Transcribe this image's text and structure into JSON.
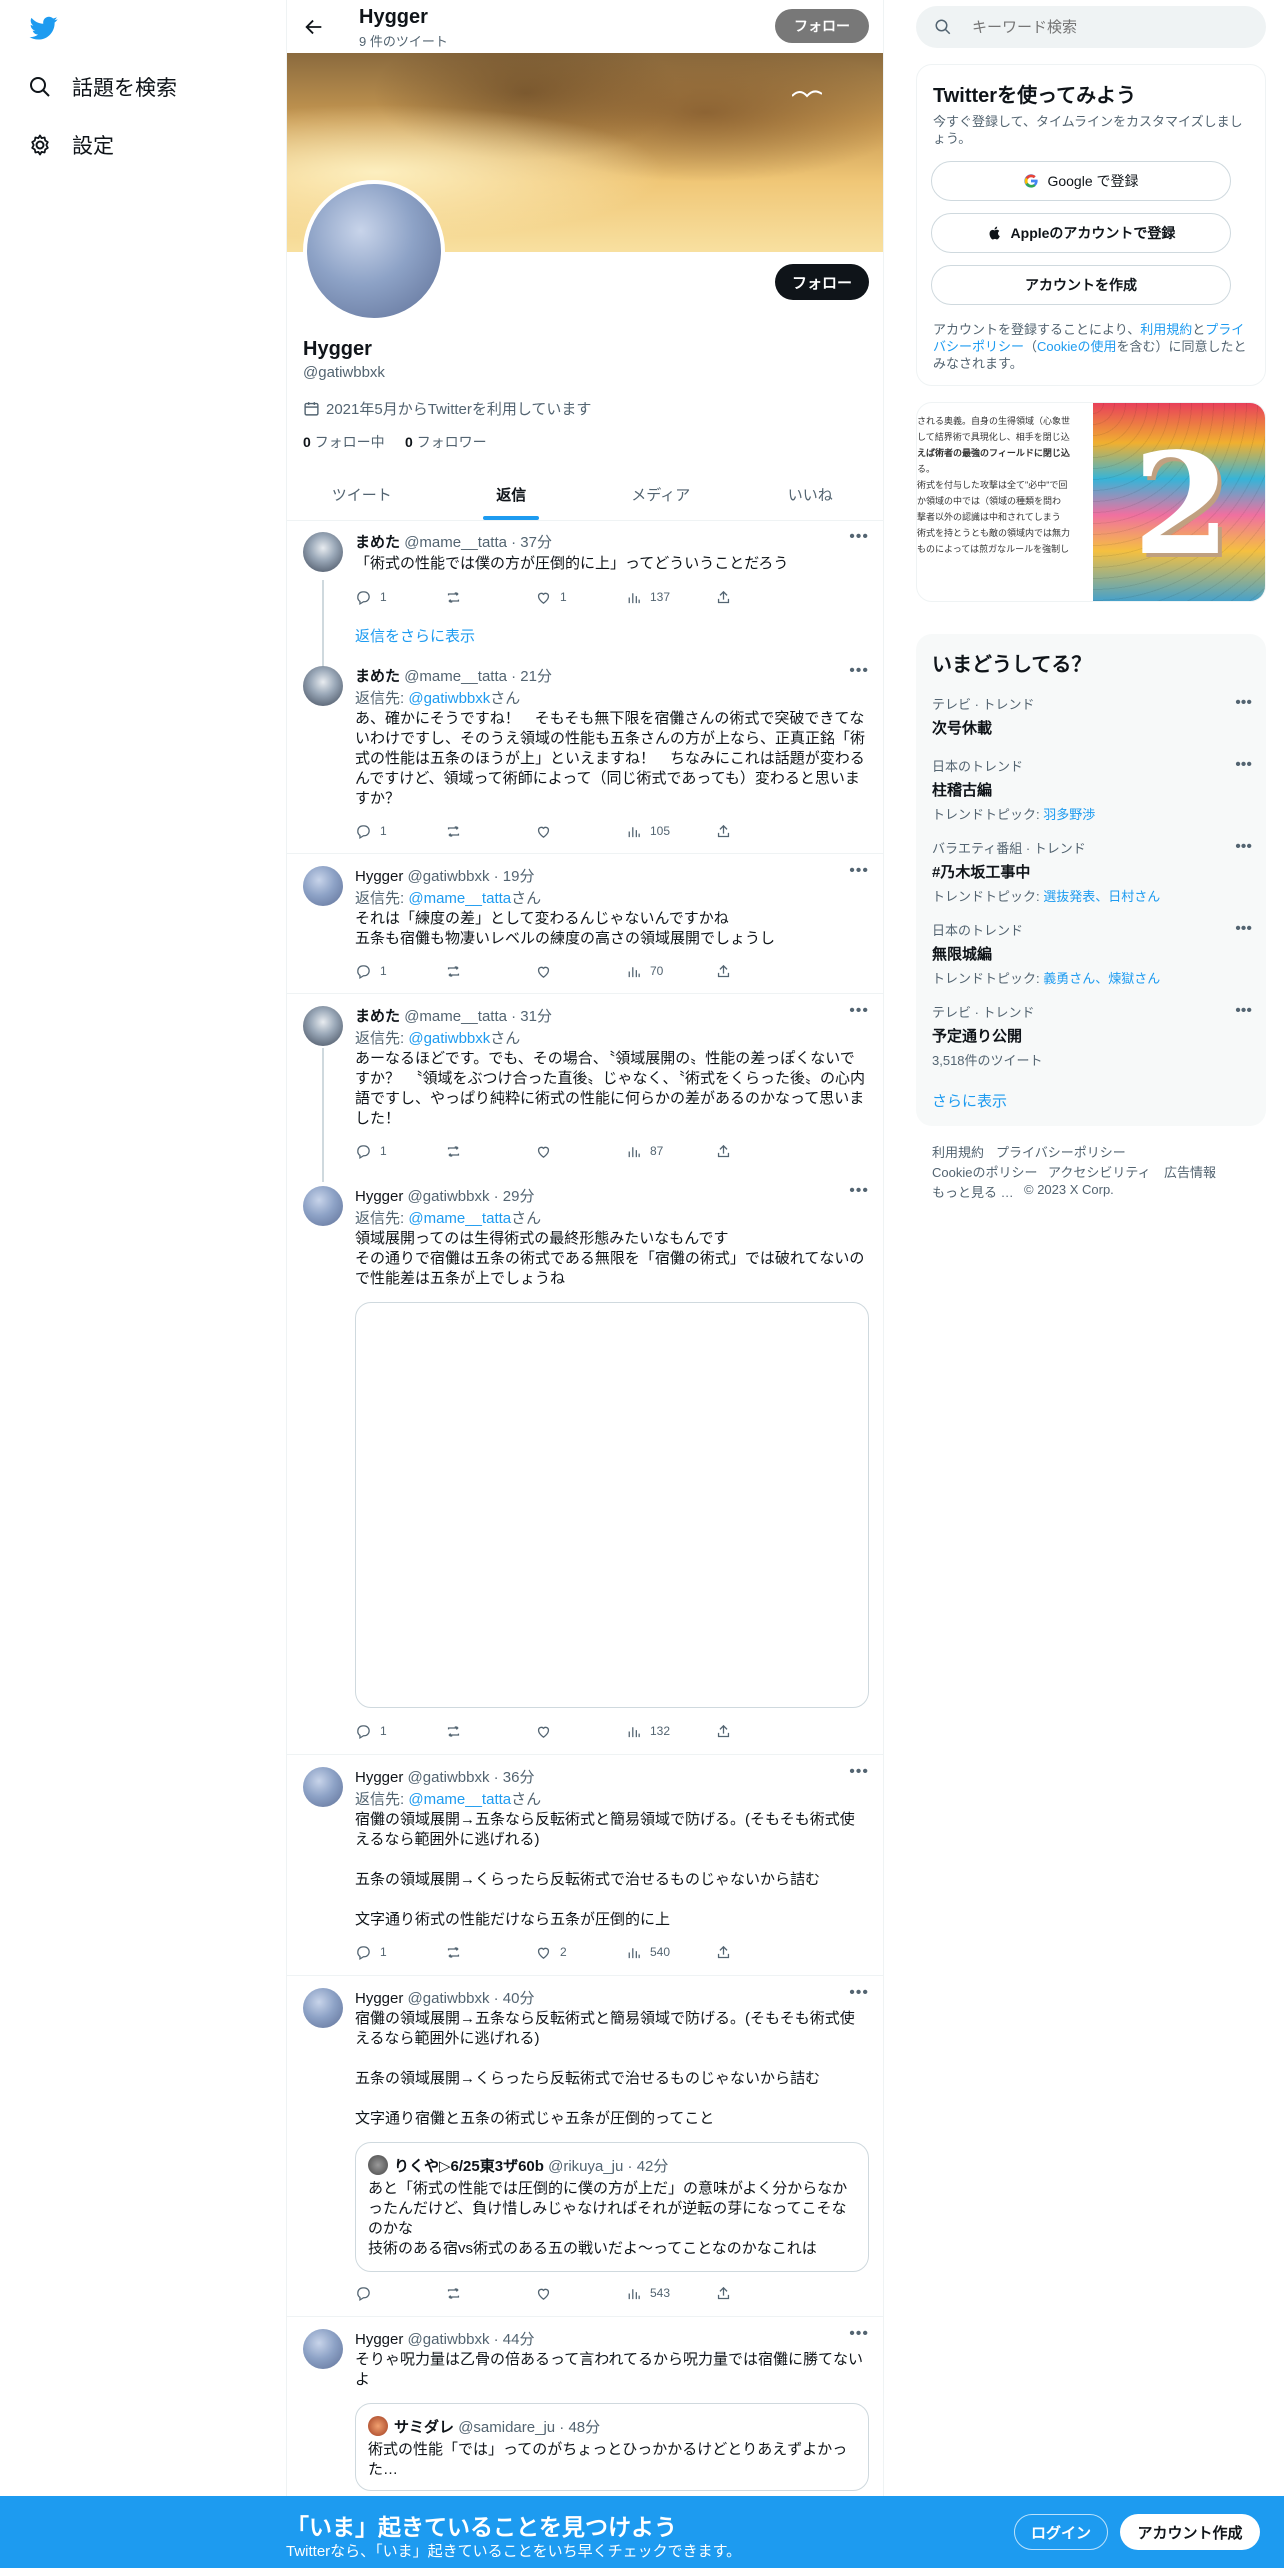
{
  "nav": {
    "items": [
      {
        "label": "話題を検索",
        "icon": "search-icon"
      },
      {
        "label": "設定",
        "icon": "gear-icon"
      }
    ]
  },
  "header": {
    "name": "Hygger",
    "tweet_count": "9 件のツイート",
    "follow_label": "フォロー"
  },
  "profile": {
    "follow_label": "フォロー",
    "name": "Hygger",
    "handle": "@gatiwbbxk",
    "joined": "2021年5月からTwitterを利用しています",
    "following_count": "0",
    "following_label": "フォロー中",
    "followers_count": "0",
    "followers_label": "フォロワー"
  },
  "tabs": [
    "ツイート",
    "返信",
    "メディア",
    "いいね"
  ],
  "show_more_replies": "返信をさらに表示",
  "tweets": [
    {
      "name": "まめた",
      "handle": "@mame__tatta",
      "time": "· 37分",
      "text": "「術式の性能では僕の方が圧倒的に上」ってどういうことだろう",
      "replies": "1",
      "retweets": "",
      "likes": "1",
      "views": "137"
    },
    {
      "name": "まめた",
      "handle": "@mame__tatta",
      "time": "· 21分",
      "reply_prefix": "返信先: ",
      "reply_to": "@gatiwbbxk",
      "reply_suffix": "さん",
      "text": "あ、確かにそうですね！　そもそも無下限を宿儺さんの術式で突破できてないわけですし、そのうえ領域の性能も五条さんの方が上なら、正真正銘「術式の性能は五条のほうが上」といえますね！　ちなみにこれは話題が変わるんですけど、領域って術師によって（同じ術式であっても）変わると思いますか？",
      "replies": "1",
      "retweets": "",
      "likes": "",
      "views": "105"
    },
    {
      "name": "Hygger",
      "handle": "@gatiwbbxk",
      "time": "· 19分",
      "reply_prefix": "返信先: ",
      "reply_to": "@mame__tatta",
      "reply_suffix": "さん",
      "text": "それは「練度の差」として変わるんじゃないんですかね\n五条も宿儺も物凄いレベルの練度の高さの領域展開でしょうし",
      "replies": "1",
      "retweets": "",
      "likes": "",
      "views": "70"
    },
    {
      "name": "まめた",
      "handle": "@mame__tatta",
      "time": "· 31分",
      "reply_prefix": "返信先: ",
      "reply_to": "@gatiwbbxk",
      "reply_suffix": "さん",
      "text": "あーなるほどです。でも、その場合、〝領域展開の〟性能の差っぽくないですか？　〝領域をぶつけ合った直後〟じゃなく、〝術式をくらった後〟の心内語ですし、やっぱり純粋に術式の性能に何らかの差があるのかなって思いました！",
      "replies": "1",
      "retweets": "",
      "likes": "",
      "views": "87"
    },
    {
      "name": "Hygger",
      "handle": "@gatiwbbxk",
      "time": "· 29分",
      "reply_prefix": "返信先: ",
      "reply_to": "@mame__tatta",
      "reply_suffix": "さん",
      "text": "領域展開ってのは生得術式の最終形態みたいなもんです\nその通りで宿儺は五条の術式である無限を「宿儺の術式」では破れてないので性能差は五条が上でしょうね",
      "replies": "1",
      "retweets": "",
      "likes": "",
      "views": "132"
    },
    {
      "name": "Hygger",
      "handle": "@gatiwbbxk",
      "time": "· 36分",
      "reply_prefix": "返信先: ",
      "reply_to": "@mame__tatta",
      "reply_suffix": "さん",
      "text": "宿儺の領域展開→五条なら反転術式と簡易領域で防げる。(そもそも術式使えるなら範囲外に逃げれる)\n\n五条の領域展開→くらったら反転術式で治せるものじゃないから詰む\n\n文字通り術式の性能だけなら五条が圧倒的に上",
      "replies": "1",
      "retweets": "",
      "likes": "2",
      "views": "540"
    },
    {
      "name": "Hygger",
      "handle": "@gatiwbbxk",
      "time": "· 40分",
      "text": "宿儺の領域展開→五条なら反転術式と簡易領域で防げる。(そもそも術式使えるなら範囲外に逃げれる)\n\n五条の領域展開→くらったら反転術式で治せるものじゃないから詰む\n\n文字通り宿儺と五条の術式じゃ五条が圧倒的ってこと",
      "quote": {
        "name": "りくや▷6/25東3ザ60b",
        "handle": "@rikuya_ju",
        "time": "· 42分",
        "text": "あと「術式の性能では圧倒的に僕の方が上だ」の意味がよく分からなかったんだけど、負け惜しみじゃなければそれが逆転の芽になってこそなのかな\n技術のある宿vs術式のある五の戦いだよ〜ってことなのかなこれは"
      },
      "replies": "",
      "retweets": "",
      "likes": "",
      "views": "543"
    },
    {
      "name": "Hygger",
      "handle": "@gatiwbbxk",
      "time": "· 44分",
      "text": "そりゃ呪力量は乙骨の倍あるって言われてるから呪力量では宿儺に勝てないよ",
      "quote": {
        "name": "サミダレ",
        "handle": "@samidare_ju",
        "time": "· 48分",
        "text": "術式の性能「では」ってのがちょっとひっかかるけどとりあえずよかった…"
      }
    }
  ],
  "right": {
    "search_placeholder": "キーワード検索",
    "signup": {
      "title": "Twitterを使ってみよう",
      "subtitle": "今すぐ登録して、タイムラインをカスタマイズしましょう。",
      "google": "Google で登録",
      "apple": "Appleのアカウントで登録",
      "create": "アカウントを作成",
      "terms_1": "アカウントを登録することにより、",
      "terms_link1": "利用規約",
      "terms_2": "と",
      "terms_link2": "プライバシーポリシー",
      "terms_3": "（",
      "terms_link3": "Cookieの使用",
      "terms_4": "を含む）に同意したとみなされます。"
    },
    "ad": {
      "lines": [
        "される奥義。自身の生得領域（心象世",
        "して結界術で具現化し、相手を閉じ込",
        "えば術者の最強のフィールドに閉じ込",
        "る。",
        "術式を付与した攻撃は全て\"必中\"で回",
        "か領域の中では（領域の種類を問わ",
        "撃者以外の認識は中和されてしまう",
        "術式を持とうとも敵の領域内では無力",
        "ものによっては煎ガなルールを強制し"
      ],
      "numeral": "2"
    },
    "trends": {
      "title": "いまどうしてる？",
      "items": [
        {
          "cat": "テレビ · トレンド",
          "title": "次号休載",
          "sub": ""
        },
        {
          "cat": "日本のトレンド",
          "title": "柱稽古編",
          "sub_prefix": "トレンドトピック: ",
          "sub_links": "羽多野渉"
        },
        {
          "cat": "バラエティ番組 · トレンド",
          "title": "#乃木坂工事中",
          "sub_prefix": "トレンドトピック: ",
          "sub_links": "選抜発表、日村さん"
        },
        {
          "cat": "日本のトレンド",
          "title": "無限城編",
          "sub_prefix": "トレンドトピック: ",
          "sub_links": "義勇さん、煉獄さん"
        },
        {
          "cat": "テレビ · トレンド",
          "title": "予定通り公開",
          "sub": "3,518件のツイート"
        }
      ],
      "show_more": "さらに表示"
    },
    "footer": {
      "links": [
        "利用規約",
        "プライバシーポリシー",
        "Cookieのポリシー",
        "アクセシビリティ",
        "広告情報",
        "もっと見る …",
        "© 2023 X Corp."
      ]
    }
  },
  "bottom_bar": {
    "title": "「いま」起きていることを見つけよう",
    "subtitle": "Twitterなら、「いま」起きていることをいち早くチェックできます。",
    "login": "ログイン",
    "signup": "アカウント作成"
  },
  "colors": {
    "accent": "#1d9bf0",
    "text": "#0f1419",
    "muted": "#536471"
  }
}
